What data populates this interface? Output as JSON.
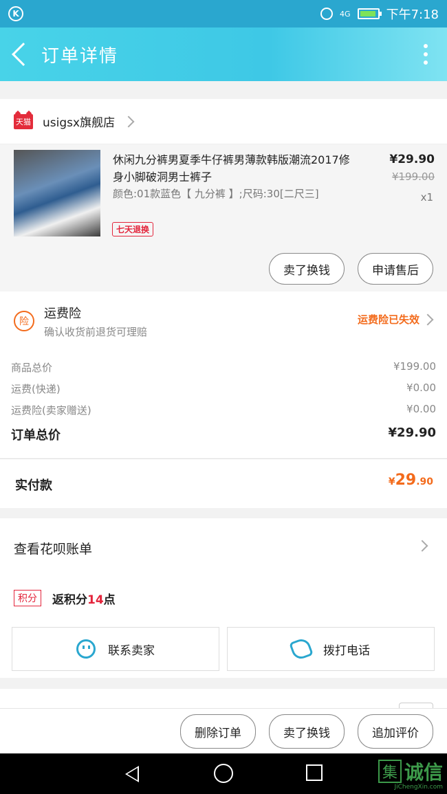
{
  "status_bar": {
    "time": "下午7:18",
    "network": "4G"
  },
  "header": {
    "title": "订单详情"
  },
  "shop": {
    "name": "usigsx旗舰店",
    "platform_badge": "天猫"
  },
  "product": {
    "title": "休闲九分裤男夏季牛仔裤男薄款韩版潮流2017修身小脚破洞男士裤子",
    "attributes": "颜色:01款蓝色【 九分裤 】;尺码:30[二尺三]",
    "badge": "七天退换",
    "price": "¥29.90",
    "original_price": "¥199.00",
    "quantity": "x1",
    "buttons": [
      "卖了换钱",
      "申请售后"
    ]
  },
  "insurance": {
    "icon_text": "险",
    "title": "运费险",
    "subtitle": "确认收货前退货可理赔",
    "status": "运费险已失效"
  },
  "summary": {
    "rows": [
      {
        "label": "商品总价",
        "value": "¥199.00"
      },
      {
        "label": "运费(快递)",
        "value": "¥0.00"
      },
      {
        "label": "运费险(卖家赠送)",
        "value": "¥0.00"
      }
    ],
    "total_label": "订单总价",
    "total_value": "¥29.90"
  },
  "payment": {
    "label": "实付款",
    "amount_currency": "¥",
    "amount_main": "29",
    "amount_decimal": ".90"
  },
  "huabei": {
    "label": "查看花呗账单"
  },
  "points": {
    "tag": "积分",
    "prefix": "返积分",
    "value": "14",
    "suffix": "点"
  },
  "contact": {
    "seller_label": "联系卖家",
    "call_label": "拨打电话"
  },
  "actions": [
    "删除订单",
    "卖了换钱",
    "追加评价"
  ],
  "watermark": {
    "char": "集",
    "text": "诚信",
    "sub": "JiChengXin.com"
  },
  "colors": {
    "accent": "#f36b1c",
    "tmall_red": "#e32c3b",
    "header_start": "#48d3e8",
    "header_end": "#7fe3f2"
  }
}
